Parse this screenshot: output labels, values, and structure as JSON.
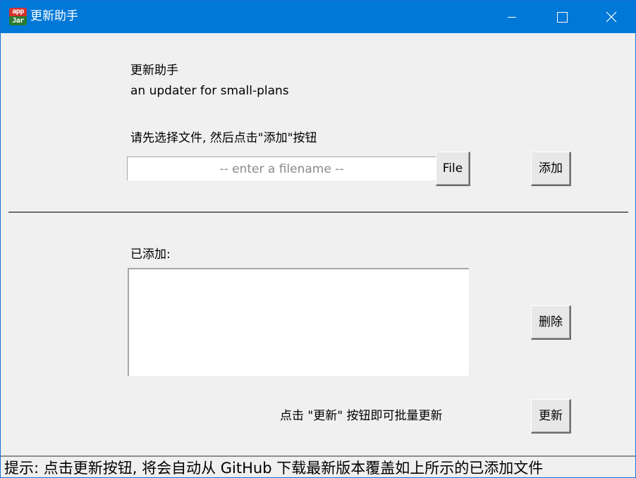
{
  "window": {
    "title": "更新助手",
    "icon": {
      "name": "appjar-icon",
      "line1": "app",
      "line2": "Jar"
    },
    "controls": [
      "minimize-icon",
      "maximize-icon",
      "close-icon"
    ]
  },
  "header": {
    "title": "更新助手",
    "subtitle": "an updater for small-plans"
  },
  "select": {
    "instruction": "请先选择文件, 然后点击\"添加\"按钮",
    "placeholder": "-- enter a filename --",
    "value": "",
    "file_button": "File",
    "add_button": "添加"
  },
  "added": {
    "label": "已添加:",
    "items": [],
    "delete_button": "删除"
  },
  "update": {
    "hint": "点击 \"更新\" 按钮即可批量更新",
    "button": "更新"
  },
  "status": {
    "text": "提示: 点击更新按钮, 将会自动从 GitHub 下载最新版本覆盖如上所示的已添加文件"
  },
  "colors": {
    "titlebar": "#0078d7",
    "background": "#f0f0f0",
    "button_face": "#e8e8e8"
  }
}
